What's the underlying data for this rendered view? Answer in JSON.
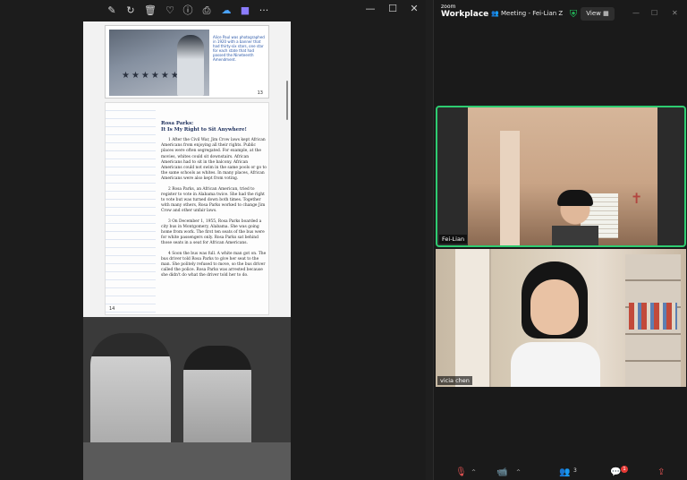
{
  "viewer": {
    "toolbar_icons": [
      "edit-icon",
      "rotate-icon",
      "delete-icon",
      "favorite-icon",
      "info-icon",
      "print-icon",
      "onedrive-icon",
      "clipchamp-icon",
      "more-icon"
    ],
    "more_glyph": "···",
    "window_controls": {
      "minimize": "—",
      "maximize": "☐",
      "close": "✕"
    },
    "doc": {
      "top_page_number": "13",
      "photo_caption": "Alice Paul was photographed in 1920 with a banner that had thirty-six stars, one star for each state that had passed the Nineteenth Amendment.",
      "article_title_line1": "Rosa Parks:",
      "article_title_line2": "It Is My Right to Sit Anywhere!",
      "paragraphs": [
        "1 After the Civil War, Jim Crow laws kept African Americans from enjoying all their rights. Public places were often segregated. For example, at the movies, whites could sit downstairs. African Americans had to sit in the balcony. African Americans could not swim in the same pools or go to the same schools as whites. In many places, African Americans were also kept from voting.",
        "2 Rosa Parks, an African American, tried to register to vote in Alabama twice. She had the right to vote but was turned down both times. Together with many others, Rosa Parks worked to change Jim Crow and other unfair laws.",
        "3 On December 1, 1955, Rosa Parks boarded a city bus in Montgomery, Alabama. She was going home from work. The first ten seats of the bus were for white passengers only. Rosa Parks sat behind those seats in a seat for African Americans.",
        "4 Soon the bus was full. A white man got on. The bus driver told Rosa Parks to give her seat to the man. She politely refused to move, so the bus driver called the police. Rosa Parks was arrested because she didn't do what the driver told her to do."
      ],
      "bottom_page_number": "14"
    }
  },
  "zoom": {
    "logo_line1": "zoom",
    "logo_line2": "Workplace",
    "meeting_title": "Meeting - Fei-Lian Z",
    "view_label": "View",
    "window_controls": {
      "minimize": "—",
      "maximize": "☐",
      "close": "✕"
    },
    "participants": [
      {
        "name": "Fei-Lian",
        "active_speaker": true
      },
      {
        "name": "vicia chen",
        "active_speaker": false
      }
    ],
    "bottom_bar": {
      "participants_count": "3",
      "chat_badge": "1"
    },
    "colors": {
      "active_speaker_border": "#2ecc71",
      "muted_red": "#e55353",
      "secure_green": "#22c55e"
    }
  }
}
